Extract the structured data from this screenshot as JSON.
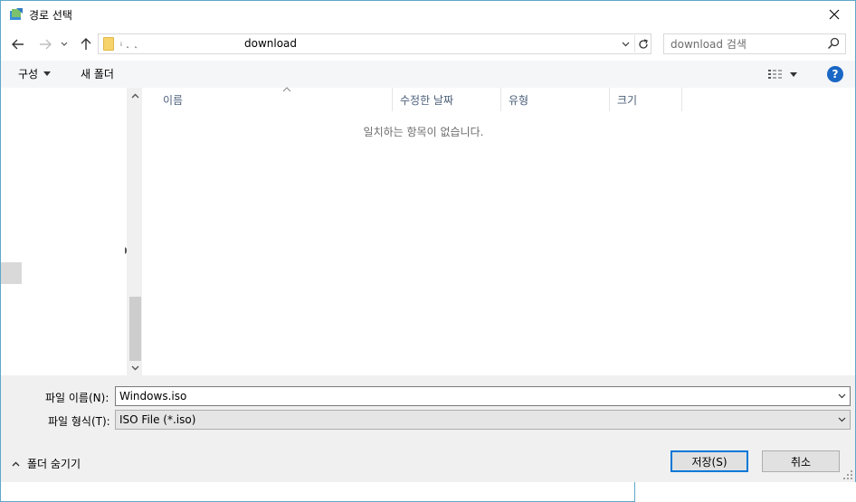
{
  "window": {
    "title": "경로 선택",
    "close_label": "✕"
  },
  "navigation": {
    "address_prefix": "ᵢ                 ˛   ˛",
    "address_path": "download",
    "search_placeholder": "download 검색"
  },
  "toolbar": {
    "organize_label": "구성",
    "new_folder_label": "새 폴더",
    "help_label": "?"
  },
  "file_list": {
    "columns": [
      {
        "label": "이름"
      },
      {
        "label": "수정한 날짜"
      },
      {
        "label": "유형"
      },
      {
        "label": "크기"
      }
    ],
    "empty_message": "일치하는 항목이 없습니다."
  },
  "bottom": {
    "filename_label": "파일 이름(N):",
    "filename_value": "Windows.iso",
    "filetype_label": "파일 형식(T):",
    "filetype_value": "ISO File (*.iso)",
    "hide_folders_label": "폴더 숨기기",
    "save_label": "저장(S)",
    "cancel_label": "취소"
  },
  "colors": {
    "accent": "#0078d7",
    "border": "#5fa7c9",
    "panel_bg": "#f0f0f0",
    "header_text": "#4c607a"
  }
}
